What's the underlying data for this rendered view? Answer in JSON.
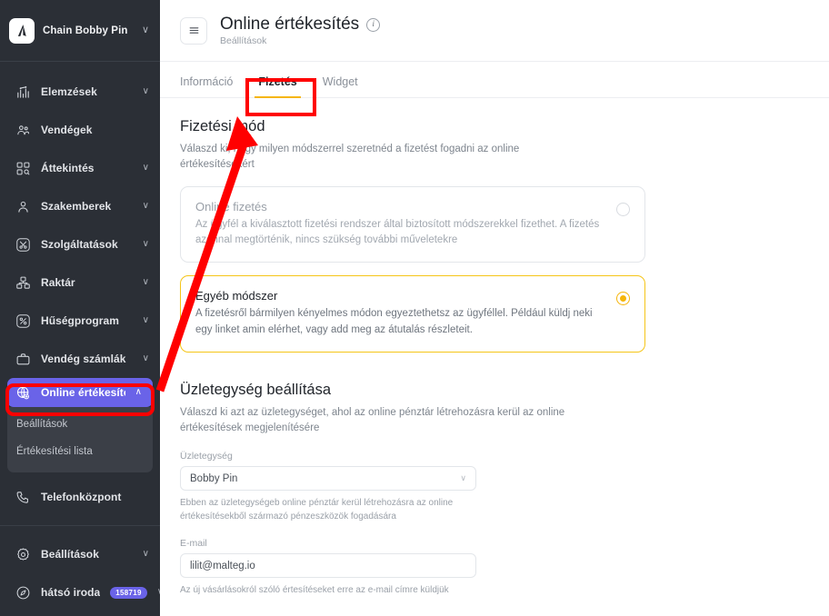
{
  "sidebar": {
    "brand": {
      "name": "Chain Bobby Pin",
      "logo_icon": "logo-mark",
      "chevron": "∨"
    },
    "items": [
      {
        "label": "Elemzések",
        "icon": "analytics-icon",
        "chevron": "∨",
        "has_chevron": true
      },
      {
        "label": "Vendégek",
        "icon": "guests-icon",
        "chevron": "",
        "has_chevron": false
      },
      {
        "label": "Áttekintés",
        "icon": "overview-icon",
        "chevron": "∨",
        "has_chevron": true
      },
      {
        "label": "Szakemberek",
        "icon": "person-icon",
        "chevron": "∨",
        "has_chevron": true
      },
      {
        "label": "Szolgáltatások",
        "icon": "scissors-icon",
        "chevron": "∨",
        "has_chevron": true
      },
      {
        "label": "Raktár",
        "icon": "warehouse-icon",
        "chevron": "∨",
        "has_chevron": true
      },
      {
        "label": "Hűségprogram",
        "icon": "percent-icon",
        "chevron": "∨",
        "has_chevron": true
      },
      {
        "label": "Vendég számlák",
        "icon": "briefcase-icon",
        "chevron": "∨",
        "has_chevron": true
      }
    ],
    "active_item": {
      "label": "Online értékesítés",
      "icon": "globe-icon",
      "chevron": "∧"
    },
    "sub_items": [
      {
        "label": "Beállítások"
      },
      {
        "label": "Értékesítési lista"
      }
    ],
    "after_items": [
      {
        "label": "Telefonközpont",
        "icon": "phone-icon",
        "has_chevron": false
      }
    ],
    "bottom_items": [
      {
        "label": "Beállítások",
        "icon": "gear-icon",
        "chevron": "∨",
        "has_chevron": true,
        "badge": ""
      },
      {
        "label": "hátsó iroda",
        "icon": "compass-icon",
        "chevron": "∨",
        "has_chevron": true,
        "badge": "158719"
      }
    ],
    "colors": {
      "active_bg": "#6a63e8",
      "bg": "#2b2f36",
      "sub_bg": "#3b3f47"
    }
  },
  "header": {
    "menu_icon": "hamburger-icon",
    "title": "Online értékesítés",
    "info_icon": "i",
    "subtitle": "Beállítások"
  },
  "tabs": [
    {
      "label": "Információ",
      "active": false
    },
    {
      "label": "Fizetés",
      "active": true
    },
    {
      "label": "Widget",
      "active": false
    }
  ],
  "payment_section": {
    "title": "Fizetési mód",
    "description": "Válaszd ki, hogy milyen módszerrel szeretnéd a fizetést fogadni az online értékesítésekért",
    "options": [
      {
        "title": "Online fizetés",
        "description": "Az ügyfél a kiválasztott fizetési rendszer által biztosított módszerekkel fizethet. A fizetés azonnal megtörténik, nincs szükség további műveletekre",
        "selected": false
      },
      {
        "title": "Egyéb módszer",
        "description": "A fizetésről bármilyen kényelmes módon egyeztethetsz az ügyféllel. Például küldj neki egy linket amin elérhet, vagy add meg az átutalás részleteit.",
        "selected": true
      }
    ]
  },
  "business_section": {
    "title": "Üzletegység beállítása",
    "description": "Válaszd ki azt az üzletegységet, ahol az online pénztár létrehozásra kerül az online értékesítések megjelenítésére",
    "unit_label": "Üzletegység",
    "unit_value": "Bobby Pin",
    "unit_chevron": "∨",
    "unit_hint": "Ebben az üzletegységeb online pénztár kerül létrehozásra az online értékesítésekből származó pénzeszközök fogadására",
    "email_label": "E-mail",
    "email_value": "lilit@malteg.io",
    "email_hint": "Az új vásárlásokról szóló értesítéseket erre az e-mail címre küldjük"
  },
  "annotation": {
    "color": "#ff0000",
    "highlight_target": "tab-fizetes",
    "arrow_from": "sidebar-active-item",
    "arrow_to": "tab-fizetes"
  }
}
